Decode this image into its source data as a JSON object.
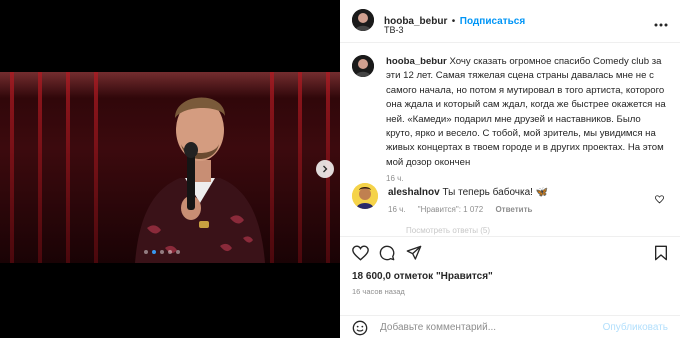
{
  "post": {
    "username": "hooba_bebur",
    "separator": "•",
    "follow_label": "Подписаться",
    "location": "ТВ-3"
  },
  "caption": {
    "username": "hooba_bebur",
    "text": "Хочу сказать огромное спасибо Comedy club за эти 12 лет. Самая тяжелая сцена страны давалась мне не с самого начала, но потом я мутировал в того артиста, которого она ждала и который сам ждал, когда же быстрее окажется на ней. «Камеди» подарил мне друзей и наставников. Было круто, ярко и весело. С тобой, мой зритель, мы увидимся на живых концертах в твоем городе и в других проектах. На этом мой дозор окончен",
    "time": "16 ч."
  },
  "comment": {
    "username": "aleshalnov",
    "text": "Ты теперь бабочка! 🦋",
    "time": "16 ч.",
    "likes": "\"Нравится\": 1 072",
    "reply_label": "Ответить"
  },
  "hidden_replies_label": "Посмотреть ответы (5)",
  "carousel": {
    "slide_count": 5,
    "active_index": 1
  },
  "stats": {
    "likes_text": "18 600,0 отметок \"Нравится\"",
    "posted_ago": "16 часов назад"
  },
  "comment_form": {
    "placeholder": "Добавьте комментарий...",
    "publish_label": "Опубликовать"
  },
  "icons": [
    "heart-icon",
    "comment-icon",
    "share-icon",
    "bookmark-icon",
    "emoji-icon",
    "more-icon",
    "chevron-right-icon"
  ],
  "colors": {
    "accent": "#0095f6",
    "text": "#262626",
    "muted": "#8e8e8e",
    "publish_disabled": "#b2dffc"
  }
}
